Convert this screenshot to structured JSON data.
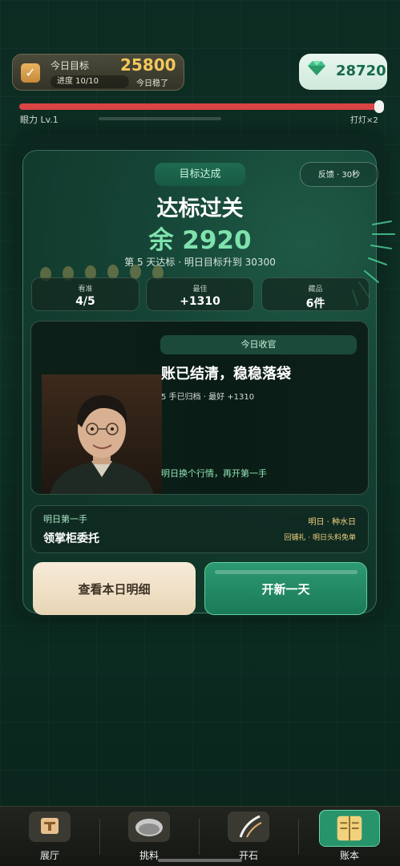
{
  "hud": {
    "goal_label": "今日目标",
    "goal_value": "25800",
    "progress": "进度 10/10",
    "stable": "今日稳了",
    "gems": "28720"
  },
  "eye": {
    "label": "眼力 Lv.1",
    "light": "打灯×2",
    "level_fraction": 1.0
  },
  "card": {
    "badge": "目标达成",
    "feedback": "反馈 · 30秒",
    "title": "达标过关",
    "remain": "余 2920",
    "day_info": "第 5 天达标 · 明日目标升到 30300",
    "stats": [
      {
        "label": "看准",
        "value": "4/5"
      },
      {
        "label": "最佳",
        "value": "+1310"
      },
      {
        "label": "藏品",
        "value": "6件"
      }
    ],
    "harvest": {
      "tag": "今日收官",
      "title": "账已结清，稳稳落袋",
      "sub": "5 手已归档 · 最好 +1310",
      "foot": "明日换个行情，再开第一手"
    },
    "tomorrow": {
      "label": "明日第一手",
      "main": "领掌柜委托",
      "right1": "明日 · 种水日",
      "right2": "回铺礼 · 明日头料免单"
    },
    "btn_detail": "查看本日明细",
    "btn_new": "开新一天"
  },
  "nav": [
    {
      "label": "展厅",
      "icon": "display-case-icon"
    },
    {
      "label": "挑料",
      "icon": "stone-icon"
    },
    {
      "label": "开石",
      "icon": "cutting-tool-icon"
    },
    {
      "label": "账本",
      "icon": "ledger-icon",
      "active": true
    }
  ],
  "colors": {
    "accent": "#2c9a72",
    "gold": "#f3c85b",
    "remain": "#7fe2ad",
    "eye_bar": "#d94444"
  }
}
